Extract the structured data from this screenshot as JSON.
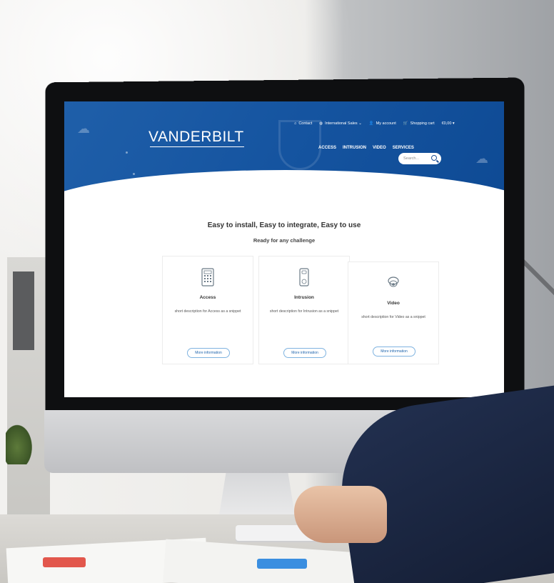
{
  "site": {
    "logo": "VANDERBILT",
    "topbar": {
      "contact": "Contact",
      "sales": "International Sales ⌄",
      "account": "My account",
      "cart": "Shopping cart",
      "cart_total": "€0,00 ▾"
    },
    "nav": [
      "ACCESS",
      "INTRUSION",
      "VIDEO",
      "SERVICES"
    ],
    "search": {
      "placeholder": "Search..."
    },
    "headline": "Easy to install, Easy to integrate, Easy to use",
    "subline": "Ready for any challenge",
    "cards": [
      {
        "title": "Access",
        "description": "short description for Access as a snippet",
        "button": "More information",
        "icon": "keypad-icon"
      },
      {
        "title": "Intrusion",
        "description": "short description for Intrusion as a snippet",
        "button": "More information",
        "icon": "sensor-icon"
      },
      {
        "title": "Video",
        "description": "short description for Video as a snippet",
        "button": "More information",
        "icon": "camera-icon"
      }
    ],
    "colors": {
      "brand_blue": "#1554a0",
      "button_text": "#2166ae"
    }
  }
}
